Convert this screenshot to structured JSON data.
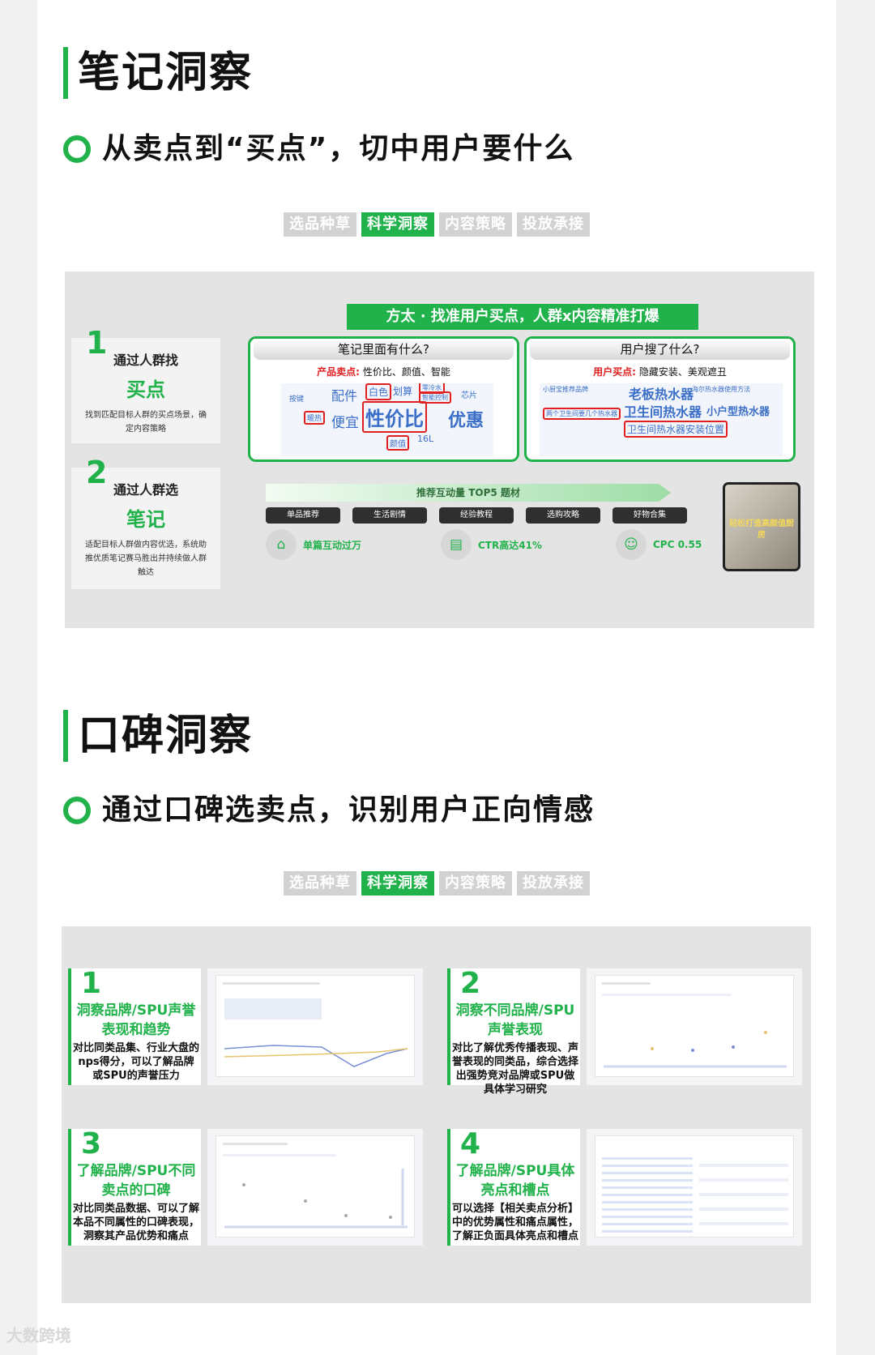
{
  "section1": {
    "title": "笔记洞察",
    "subtitle": "从卖点到“买点”，切中用户要什么",
    "tabs": [
      "选品种草",
      "科学洞察",
      "内容策略",
      "投放承接"
    ],
    "banner": "方太 · 找准用户买点，人群x内容精准打爆",
    "steps": [
      {
        "num": "1",
        "line": "通过人群找",
        "key": "买点",
        "desc": "找到匹配目标人群的买点场景，确定内容策略"
      },
      {
        "num": "2",
        "line": "通过人群选",
        "key": "笔记",
        "desc": "适配目标人群做内容优选，系统助推优质笔记赛马胜出并持续做人群触达"
      }
    ],
    "box_left": {
      "head": "笔记里面有什么?",
      "tag_label": "产品卖点:",
      "tag_value": "性价比、颜值、智能"
    },
    "box_right": {
      "head": "用户搜了什么?",
      "tag_label": "用户买点:",
      "tag_value": "隐藏安装、美观遮丑"
    },
    "cloud_left": {
      "w1": "性价比",
      "w2": "优惠",
      "w3": "便宜",
      "w4": "配件",
      "w5": "白色",
      "w6": "划算",
      "w7": "智能控制",
      "w8": "芯片",
      "w9": "颜值",
      "w10": "16L",
      "w11": "按键",
      "w12": "暖热",
      "w13": "零冷水"
    },
    "cloud_right": {
      "w1": "老板热水器",
      "w2": "卫生间热水器",
      "w3": "小户型热水器",
      "w4": "两个卫生间要几个热水器",
      "w5": "卫生间热水器安装位置",
      "w6": "海尔热水器使用方法",
      "w7": "小厨宝推荐品牌"
    },
    "strip": "推荐互动量 TOP5 题材",
    "topics": [
      "单品推荐",
      "生活剧情",
      "经验教程",
      "选购攻略",
      "好物合集"
    ],
    "metrics": [
      {
        "icon": "tag-icon",
        "text": "单篇互动过万"
      },
      {
        "icon": "document-icon",
        "text": "CTR高达41%"
      },
      {
        "icon": "people-icon",
        "text": "CPC 0.55"
      }
    ],
    "thumb_caption": "轻松打造高颜值厨房"
  },
  "section2": {
    "title": "口碑洞察",
    "subtitle": "通过口碑选卖点，识别用户正向情感",
    "tabs": [
      "选品种草",
      "科学洞察",
      "内容策略",
      "投放承接"
    ],
    "cards": [
      {
        "num": "1",
        "head": "洞察品牌/SPU声誉表现和趋势",
        "desc": "对比同类品集、行业大盘的nps得分，可以了解品牌或SPU的声誉压力"
      },
      {
        "num": "2",
        "head": "洞察不同品牌/SPU声誉表现",
        "desc": "对比了解优秀传播表现、声誉表现的同类品，综合选择出强势竞对品牌或SPU做具体学习研究"
      },
      {
        "num": "3",
        "head": "了解品牌/SPU不同卖点的口碑",
        "desc": "对比同类品数据、可以了解本品不同属性的口碑表现，洞察其产品优势和痛点"
      },
      {
        "num": "4",
        "head": "了解品牌/SPU具体亮点和槽点",
        "desc": "可以选择【相关卖点分析】中的优势属性和痛点属性，了解正负面具体亮点和槽点"
      }
    ]
  },
  "watermark": "大数跨境",
  "colors": {
    "accent": "#21b24b",
    "highlight": "#e02020",
    "cloud_text": "#3b6fc8"
  }
}
